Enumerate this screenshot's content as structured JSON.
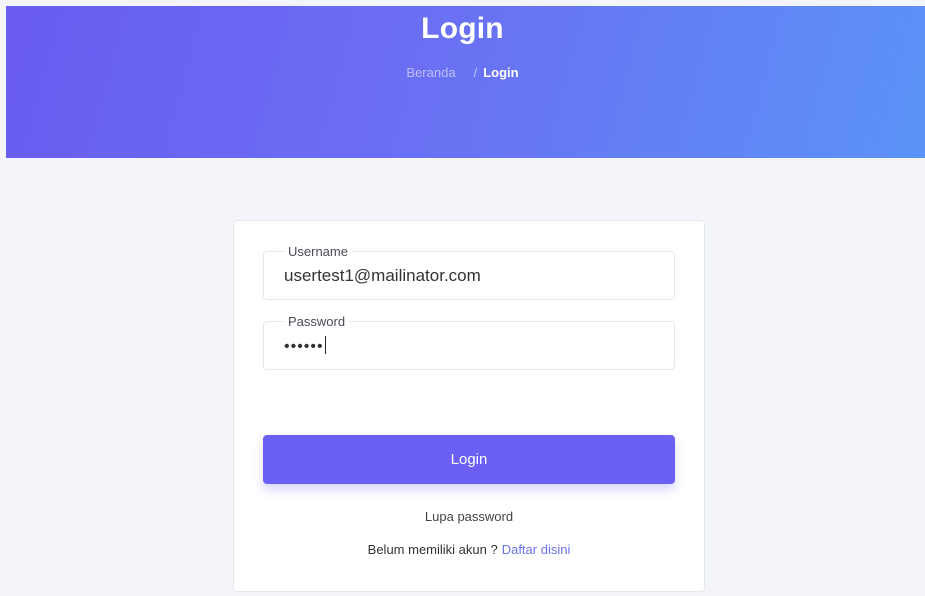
{
  "header": {
    "title": "Login",
    "breadcrumb": {
      "home": "Beranda",
      "separator": "/",
      "current": "Login"
    },
    "gradient_colors": [
      "#6a5cf0",
      "#5b93f6"
    ]
  },
  "form": {
    "username": {
      "label": "Username",
      "value": "usertest1@mailinator.com"
    },
    "password": {
      "label": "Password",
      "masked_value": "••••••"
    },
    "submit_label": "Login",
    "forgot_label": "Lupa password",
    "signup_prompt": "Belum memiliki akun ?",
    "signup_link": "Daftar disini"
  },
  "colors": {
    "accent": "#6c5ff3",
    "link": "#6c72e8",
    "background": "#f3f5fb"
  }
}
